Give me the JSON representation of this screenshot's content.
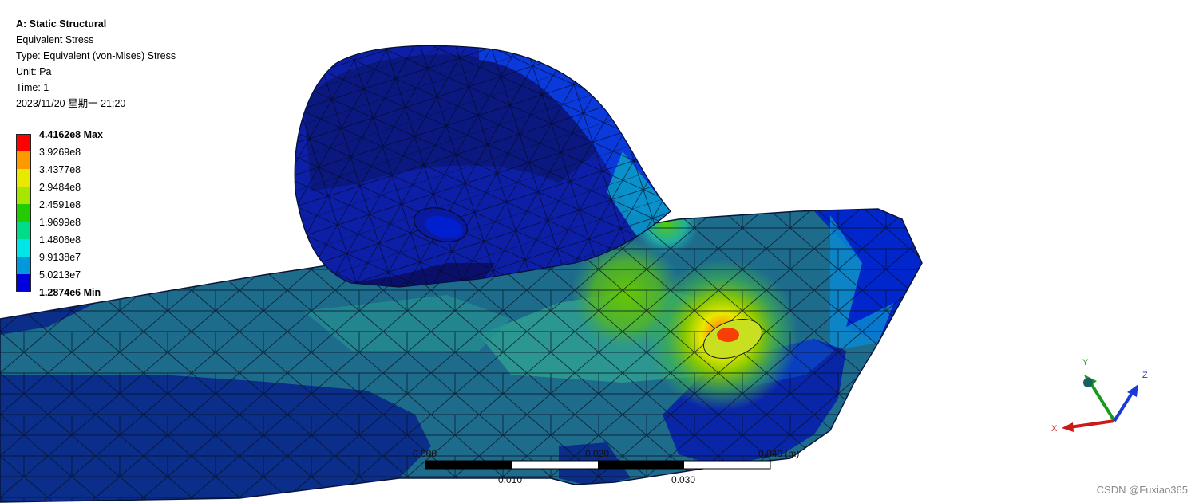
{
  "header": {
    "title": "A: Static Structural",
    "result_name": "Equivalent Stress",
    "type_line": "Type: Equivalent (von-Mises) Stress",
    "unit_line": "Unit: Pa",
    "time_line": "Time: 1",
    "date_line": "2023/11/20 星期一 21:20"
  },
  "legend": {
    "labels": [
      "4.4162e8 Max",
      "3.9269e8",
      "3.4377e8",
      "2.9484e8",
      "2.4591e8",
      "1.9699e8",
      "1.4806e8",
      "9.9138e7",
      "5.0213e7",
      "1.2874e6 Min"
    ],
    "colors": [
      "#ff0000",
      "#ff9900",
      "#e8e800",
      "#a6e600",
      "#22cc00",
      "#00dd88",
      "#00e6e6",
      "#0099dd",
      "#0000dd"
    ]
  },
  "scale_bar": {
    "top_labels": [
      "0.000",
      "0.020",
      "0.040 (m)"
    ],
    "bottom_labels": [
      "0.010",
      "0.030"
    ]
  },
  "triad": {
    "axes": [
      {
        "label": "Y",
        "color": "#1a9a1a"
      },
      {
        "label": "Z",
        "color": "#1a3ad8"
      },
      {
        "label": "X",
        "color": "#cc1a1a"
      }
    ]
  },
  "watermark": "CSDN @Fuxiao365"
}
